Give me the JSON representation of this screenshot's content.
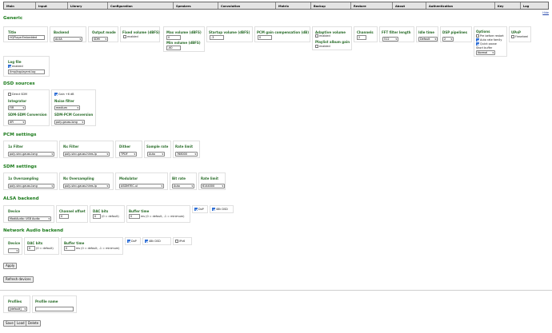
{
  "nav": [
    "Main",
    "Input",
    "Library",
    "Configuration",
    "Speakers",
    "Convolution",
    "Matrix",
    "Backup",
    "Restore",
    "About",
    "Authentication",
    "Key",
    "Log"
  ],
  "hide_link": "Hide",
  "sections": {
    "generic": "Generic",
    "dsd": "DSD sources",
    "pcm": "PCM settings",
    "sdm": "SDM settings",
    "alsa": "ALSA backend",
    "network": "Network Audio backend"
  },
  "generic": {
    "title_label": "Title",
    "title_value": "HQPlayerEmbedded",
    "backend_label": "Backend",
    "backend_value": "ALSA",
    "output_mode_label": "Output mode",
    "output_mode_value": "SDM",
    "fixed_volume_label": "Fixed volume (dBFS)",
    "fixed_volume_cb": "enabled",
    "max_volume_label": "Max volume (dBFS)",
    "max_volume_value": "0",
    "min_volume_label": "Min volume (dBFS)",
    "min_volume_value": "-60",
    "startup_volume_label": "Startup volume (dBFS)",
    "startup_volume_value": "-3",
    "pcm_gain_label": "PCM gain compensation (dB)",
    "pcm_gain_value": "0",
    "adaptive_volume_label": "Adaptive volume",
    "adaptive_volume_cb": "enabled",
    "playlist_gain_label": "Playlist album gain",
    "playlist_gain_cb": "enabled",
    "channels_label": "Channels",
    "channels_value": "2",
    "fft_label": "FFT filter length",
    "fft_value": "512",
    "idle_label": "Idle time",
    "idle_value": "Default",
    "dsp_label": "DSP pipelines",
    "dsp_value": "2",
    "options_label": "Options",
    "opt_pre_restart": "Pre before restart",
    "opt_auto_family": "Auto rate family",
    "opt_quick_pause": "Quick pause",
    "opt_short_buffer": "Short buffer",
    "opt_buffer_value": "Normal",
    "upnp_label": "UPnP",
    "upnp_cb": "Firewheel",
    "logfile_label": "Log file",
    "logfile_cb": "enabled",
    "logfile_value": "/tmp/hqplayerd.log"
  },
  "dsd": {
    "direct_sdm": "Direct SDM",
    "gain": "Gain +6 dB",
    "integrator_label": "Integrator",
    "integrator_value": "FIR",
    "noise_label": "Noise filter",
    "noise_value": "medium",
    "sdm_sdm_label": "SDM-SDM Conversion",
    "sdm_sdm_value": "XFi",
    "sdm_pcm_label": "SDM-PCM Conversion",
    "sdm_pcm_value": "poly-gauss-long"
  },
  "pcm": {
    "fx_label": "1x Filter",
    "fx_value": "poly-sinc-gauss-long",
    "nx_label": "Nx Filter",
    "nx_value": "poly-sinc-gauss-hires-lp",
    "dither_label": "Dither",
    "dither_value": "TPDF",
    "rate_label": "Sample rate",
    "rate_value": "Auto",
    "limit_label": "Rate limit",
    "limit_value": "768000"
  },
  "sdm": {
    "fx_label": "1x Oversampling",
    "fx_value": "poly-sinc-gauss-long",
    "nx_label": "Nx Oversampling",
    "nx_value": "poly-sinc-gauss-hires-lp",
    "mod_label": "Modulator",
    "mod_value": "ASDM7EC-ul",
    "bit_label": "Bit rate",
    "bit_value": "Auto",
    "limit_label": "Rate limit",
    "limit_value": "6144000"
  },
  "alsa": {
    "device_label": "Device",
    "device_value": "ModiAudio: USB Audio",
    "offset_label": "Channel offset",
    "offset_value": "0",
    "dac_label": "DAC bits",
    "dac_value": "0",
    "dac_hint": "(0 = default)",
    "buffer_label": "Buffer time",
    "buffer_value": "0",
    "buffer_hint": "ms (0 = default, -1 = minimum)",
    "dop": "DoP",
    "dsd48": "48k DSD"
  },
  "network": {
    "device_label": "Device",
    "device_value": "",
    "dac_label": "DAC bits",
    "dac_value": "0",
    "dac_hint": "(0 = default)",
    "buffer_label": "Buffer time",
    "buffer_value": "0",
    "buffer_hint": "ms (0 = default, -1 = minimum)",
    "dop": "DoP",
    "dsd48": "48k DSD",
    "ipv6": "IPv6"
  },
  "buttons": {
    "apply": "Apply",
    "refresh": "Refresh devices",
    "save": "Save",
    "load": "Load",
    "delete": "Delete"
  },
  "profiles": {
    "label": "Profiles",
    "value": "[default]",
    "name_label": "Profile name",
    "name_value": ""
  }
}
